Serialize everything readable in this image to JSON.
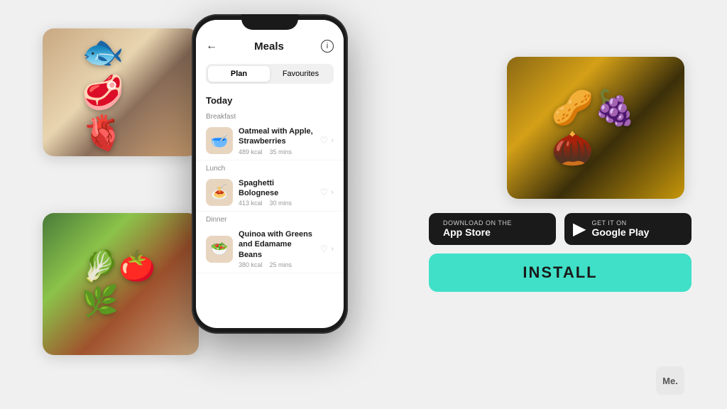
{
  "app": {
    "title": "Meals",
    "back_label": "←",
    "info_label": "i",
    "tabs": [
      {
        "id": "plan",
        "label": "Plan",
        "active": true
      },
      {
        "id": "favourites",
        "label": "Favourites",
        "active": false
      }
    ],
    "section_title": "Today",
    "categories": [
      {
        "name": "Breakfast",
        "items": [
          {
            "name": "Oatmeal with Apple, Strawberries",
            "kcal": "489 kcal",
            "time": "35 mins",
            "emoji": "🥣"
          }
        ]
      },
      {
        "name": "Lunch",
        "items": [
          {
            "name": "Spaghetti Bolognese",
            "kcal": "413 kcal",
            "time": "30 mins",
            "emoji": "🍝"
          }
        ]
      },
      {
        "name": "Dinner",
        "items": [
          {
            "name": "Quinoa with Greens and Edamame Beans",
            "kcal": "380 kcal",
            "time": "25 mins",
            "emoji": "🥗"
          }
        ]
      }
    ]
  },
  "store": {
    "app_store": {
      "label": "Download on the",
      "name": "App Store",
      "icon": ""
    },
    "google_play": {
      "label": "GET IT ON",
      "name": "Google Play",
      "icon": "▶"
    }
  },
  "install_button": {
    "label": "INSTALL"
  },
  "me_logo": {
    "label": "Me."
  },
  "images": {
    "top_left_alt": "Raw fish and meat on ice",
    "bottom_left_alt": "Fresh vegetables and spices",
    "top_right_alt": "Dried fruits and nuts in bowls"
  }
}
